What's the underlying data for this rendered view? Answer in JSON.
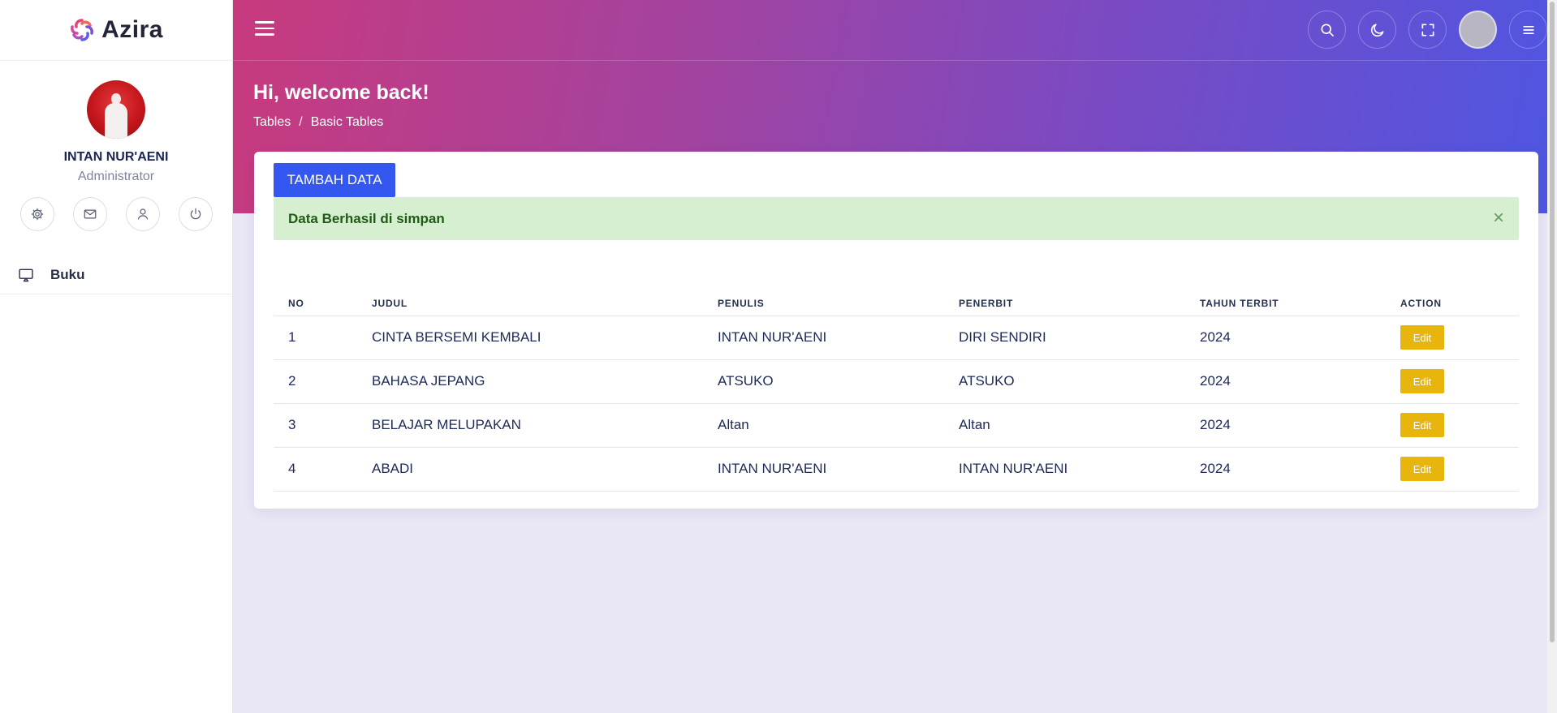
{
  "brand": {
    "name": "Azira"
  },
  "profile": {
    "name": "INTAN NUR'AENI",
    "role": "Administrator"
  },
  "profile_actions": [
    "settings",
    "mail",
    "user",
    "power"
  ],
  "sidebar": {
    "items": [
      {
        "label": "Buku",
        "icon": "monitor-icon"
      }
    ]
  },
  "header": {
    "welcome": "Hi, welcome back!",
    "breadcrumb": [
      "Tables",
      "/",
      "Basic Tables"
    ]
  },
  "card": {
    "add_button": "TAMBAH DATA",
    "alert": "Data Berhasil di simpan",
    "alert_close": "×"
  },
  "table": {
    "headers": [
      "NO",
      "JUDUL",
      "PENULIS",
      "PENERBIT",
      "TAHUN TERBIT",
      "ACTION"
    ],
    "rows": [
      {
        "no": "1",
        "judul": "CINTA BERSEMI KEMBALI",
        "penulis": "INTAN NUR'AENI",
        "penerbit": "DIRI SENDIRI",
        "tahun": "2024",
        "action": "Edit"
      },
      {
        "no": "2",
        "judul": "BAHASA JEPANG",
        "penulis": "ATSUKO",
        "penerbit": "ATSUKO",
        "tahun": "2024",
        "action": "Edit"
      },
      {
        "no": "3",
        "judul": "BELAJAR MELUPAKAN",
        "penulis": "Altan",
        "penerbit": "Altan",
        "tahun": "2024",
        "action": "Edit"
      },
      {
        "no": "4",
        "judul": "ABADI",
        "penulis": "INTAN NUR'AENI",
        "penerbit": "INTAN NUR'AENI",
        "tahun": "2024",
        "action": "Edit"
      }
    ]
  },
  "colors": {
    "primary": "#3457f0",
    "warning": "#e8b50c",
    "success_bg": "#d6efd0",
    "gradient_start": "#c83a7e",
    "gradient_end": "#4e56e2"
  }
}
